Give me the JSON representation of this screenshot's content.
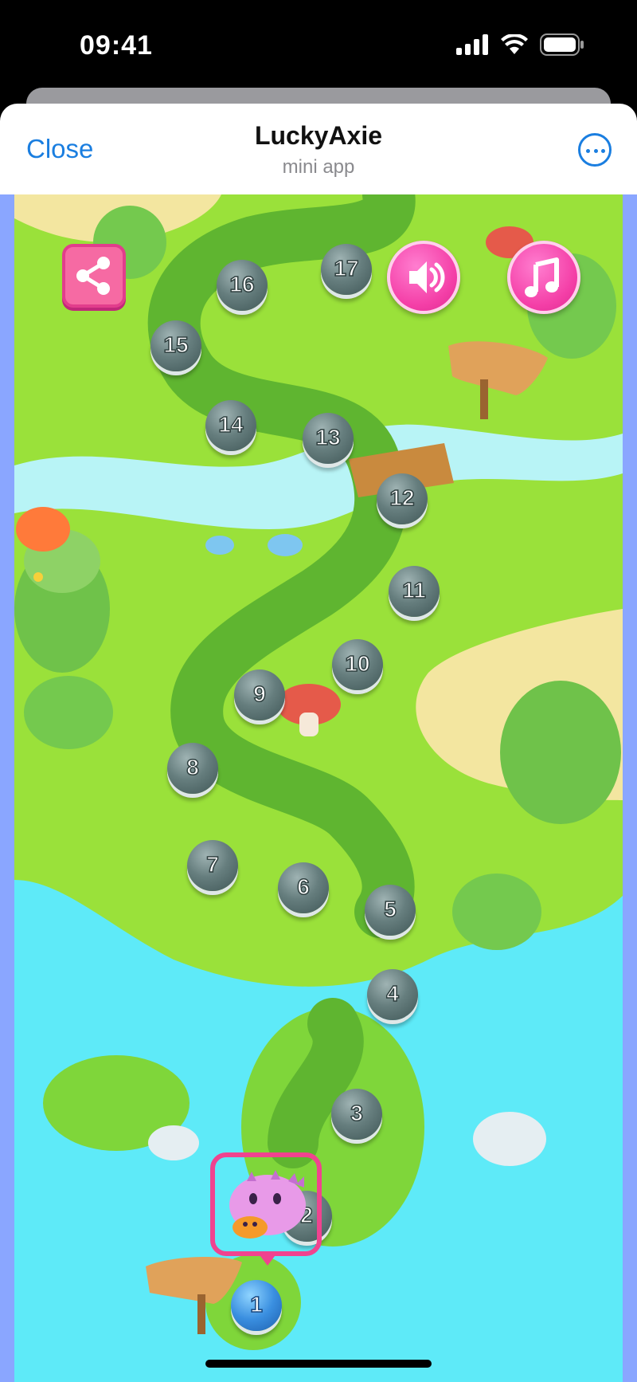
{
  "status_bar": {
    "time": "09:41",
    "signal_icon": "signal-bars-icon",
    "wifi_icon": "wifi-icon",
    "battery_icon": "battery-icon"
  },
  "header": {
    "close_label": "Close",
    "title": "LuckyAxie",
    "subtitle": "mini app",
    "more_icon": "more-options-icon"
  },
  "game": {
    "share_icon": "share-icon",
    "sound_icon": "speaker-icon",
    "music_icon": "music-note-icon",
    "levels": [
      "1",
      "2",
      "3",
      "4",
      "5",
      "6",
      "7",
      "8",
      "9",
      "10",
      "11",
      "12",
      "13",
      "14",
      "15",
      "16",
      "17"
    ],
    "current_level": "1",
    "colors": {
      "accent": "#f43fa7",
      "grass": "#9ae13a",
      "path": "#5fb530",
      "water": "#5eeaf8",
      "sand": "#f3e6a0"
    }
  }
}
